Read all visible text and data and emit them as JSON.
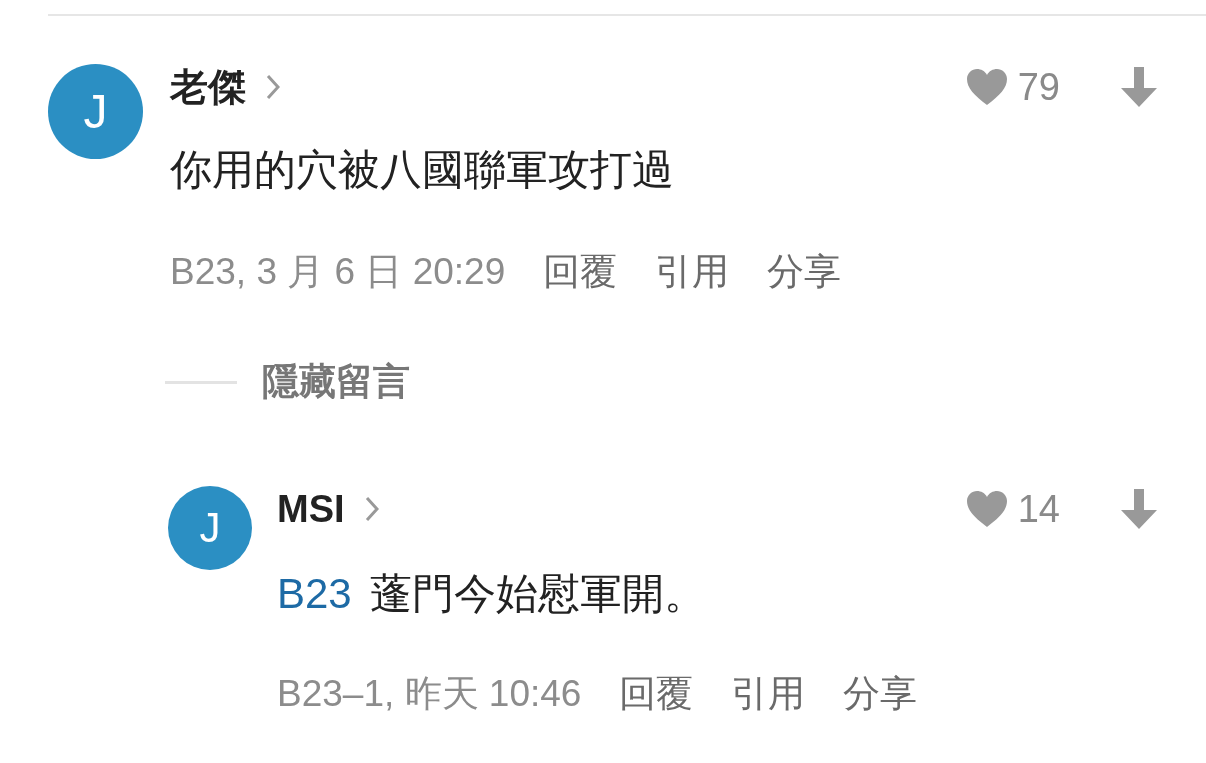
{
  "comments": [
    {
      "avatar": "J",
      "author": "老傑",
      "likes": "79",
      "body": "你用的穴被八國聯軍攻打過",
      "meta": "B23, 3 月 6 日 20:29",
      "actions": [
        "回覆",
        "引用",
        "分享"
      ]
    }
  ],
  "toggle": "隱藏留言",
  "replies": [
    {
      "avatar": "J",
      "author": "MSI",
      "likes": "14",
      "ref": "B23",
      "body": "蓬門今始慰軍開。",
      "meta": "B23–1, 昨天 10:46",
      "actions": [
        "回覆",
        "引用",
        "分享"
      ]
    }
  ]
}
